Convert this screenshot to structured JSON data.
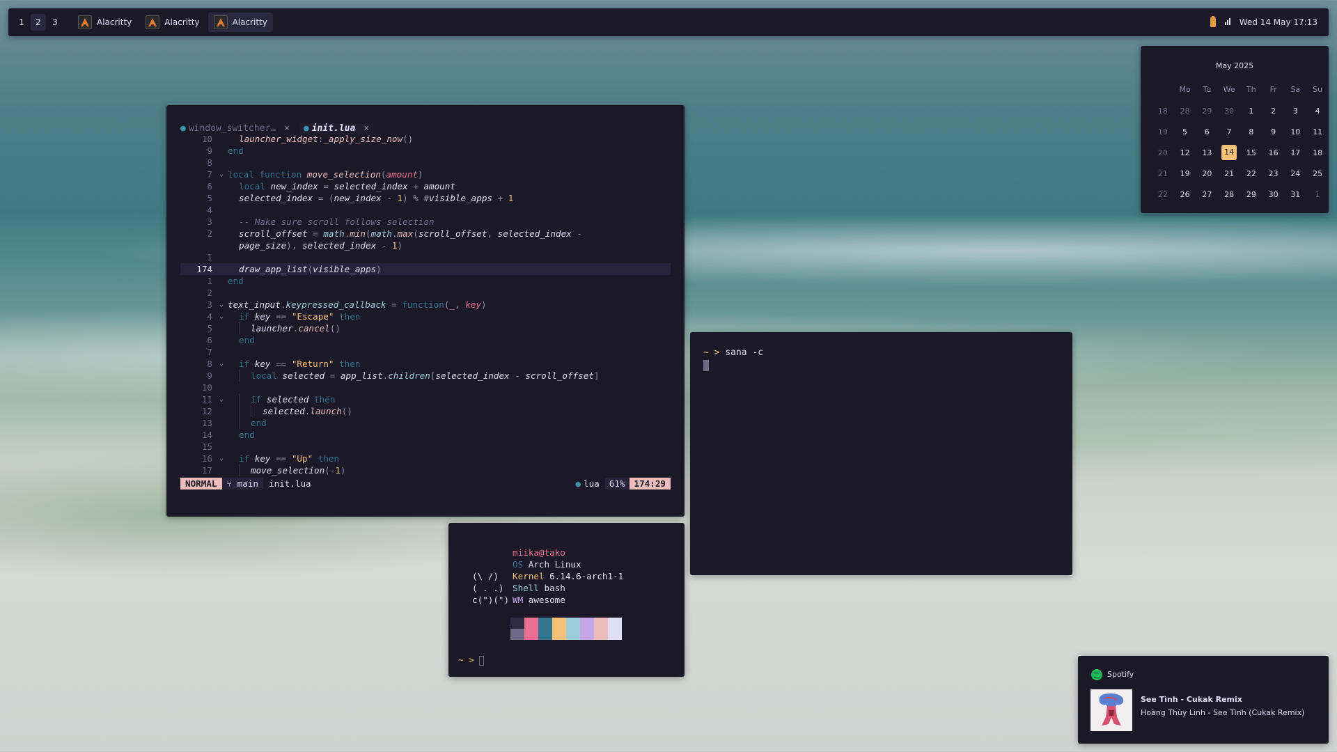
{
  "topbar": {
    "workspaces": [
      "1",
      "2",
      "3"
    ],
    "active_workspace": "2",
    "tasks": [
      {
        "label": "Alacritty",
        "icon": "alacritty-icon"
      },
      {
        "label": "Alacritty",
        "icon": "alacritty-icon"
      },
      {
        "label": "Alacritty",
        "icon": "alacritty-icon"
      }
    ],
    "clock": "Wed 14 May 17:13"
  },
  "calendar": {
    "title": "May 2025",
    "weekdays": [
      "Mo",
      "Tu",
      "We",
      "Th",
      "Fr",
      "Sa",
      "Su"
    ],
    "weeks": [
      {
        "week": "18",
        "days": [
          "28",
          "29",
          "30",
          "1",
          "2",
          "3",
          "4"
        ]
      },
      {
        "week": "19",
        "days": [
          "5",
          "6",
          "7",
          "8",
          "9",
          "10",
          "11"
        ]
      },
      {
        "week": "20",
        "days": [
          "12",
          "13",
          "14",
          "15",
          "16",
          "17",
          "18"
        ]
      },
      {
        "week": "21",
        "days": [
          "19",
          "20",
          "21",
          "22",
          "23",
          "24",
          "25"
        ]
      },
      {
        "week": "22",
        "days": [
          "26",
          "27",
          "28",
          "29",
          "30",
          "31",
          "1"
        ]
      }
    ],
    "today": "14",
    "accent": "#f6c177"
  },
  "editor": {
    "tabs": [
      {
        "label": "window_switcher…",
        "close": "×"
      },
      {
        "label": "init.lua",
        "close": "×"
      }
    ],
    "lines": [
      {
        "num": "10",
        "fold": "",
        "indent": 1,
        "tokens": [
          [
            "fn",
            "launcher_widget"
          ],
          [
            "op",
            ":"
          ],
          [
            "fn",
            "_apply_size_now"
          ],
          [
            "op",
            "()"
          ]
        ]
      },
      {
        "num": "9",
        "fold": "",
        "indent": 0,
        "tokens": [
          [
            "kw",
            "end"
          ]
        ]
      },
      {
        "num": "8",
        "fold": "",
        "indent": 0,
        "tokens": []
      },
      {
        "num": "7",
        "fold": "v",
        "indent": 0,
        "tokens": [
          [
            "kw",
            "local function "
          ],
          [
            "fn",
            "move_selection"
          ],
          [
            "op",
            "("
          ],
          [
            "pl",
            "amount"
          ],
          [
            "op",
            ")"
          ]
        ]
      },
      {
        "num": "6",
        "fold": "",
        "indent": 1,
        "tokens": [
          [
            "kw",
            "local "
          ],
          [
            "id",
            "new_index"
          ],
          [
            "op",
            " = "
          ],
          [
            "id",
            "selected_index"
          ],
          [
            "op",
            " + "
          ],
          [
            "id",
            "amount"
          ]
        ]
      },
      {
        "num": "5",
        "fold": "",
        "indent": 1,
        "tokens": [
          [
            "id",
            "selected_index"
          ],
          [
            "op",
            " = ("
          ],
          [
            "id",
            "new_index"
          ],
          [
            "op",
            " - "
          ],
          [
            "num2",
            "1"
          ],
          [
            "op",
            ") % #"
          ],
          [
            "id",
            "visible_apps"
          ],
          [
            "op",
            " + "
          ],
          [
            "num2",
            "1"
          ]
        ]
      },
      {
        "num": "4",
        "fold": "",
        "indent": 0,
        "tokens": []
      },
      {
        "num": "3",
        "fold": "",
        "indent": 1,
        "tokens": [
          [
            "cm",
            "-- Make sure scroll follows selection"
          ]
        ]
      },
      {
        "num": "2",
        "fold": "",
        "indent": 1,
        "tokens": [
          [
            "id",
            "scroll_offset"
          ],
          [
            "op",
            " = "
          ],
          [
            "fld",
            "math"
          ],
          [
            "op",
            "."
          ],
          [
            "mth",
            "min"
          ],
          [
            "op",
            "("
          ],
          [
            "fld",
            "math"
          ],
          [
            "op",
            "."
          ],
          [
            "mth",
            "max"
          ],
          [
            "op",
            "("
          ],
          [
            "id",
            "scroll_offset"
          ],
          [
            "op",
            ", "
          ],
          [
            "id",
            "selected_index"
          ],
          [
            "op",
            " -"
          ]
        ]
      },
      {
        "num": "",
        "fold": "",
        "indent": 1,
        "tokens": [
          [
            "id",
            "page_size"
          ],
          [
            "op",
            "), "
          ],
          [
            "id",
            "selected_index"
          ],
          [
            "op",
            " - "
          ],
          [
            "num2",
            "1"
          ],
          [
            "op",
            ")"
          ]
        ]
      },
      {
        "num": "1",
        "fold": "",
        "indent": 0,
        "tokens": []
      },
      {
        "num": "174",
        "fold": "",
        "indent": 1,
        "current": true,
        "tokens": [
          [
            "id",
            "draw_app_list"
          ],
          [
            "op",
            "("
          ],
          [
            "id",
            "visible_apps"
          ],
          [
            "op",
            ")"
          ]
        ]
      },
      {
        "num": "1",
        "fold": "",
        "indent": 0,
        "tokens": [
          [
            "kw",
            "end"
          ]
        ]
      },
      {
        "num": "2",
        "fold": "",
        "indent": 0,
        "tokens": []
      },
      {
        "num": "3",
        "fold": "v",
        "indent": 0,
        "tokens": [
          [
            "id",
            "text_input"
          ],
          [
            "op",
            "."
          ],
          [
            "fld",
            "keypressed_callback"
          ],
          [
            "op",
            " = "
          ],
          [
            "kw",
            "function"
          ],
          [
            "op",
            "("
          ],
          [
            "pl",
            "_"
          ],
          [
            "op",
            ", "
          ],
          [
            "pl",
            "key"
          ],
          [
            "op",
            ")"
          ]
        ]
      },
      {
        "num": "4",
        "fold": "v",
        "indent": 1,
        "tokens": [
          [
            "kw",
            "if "
          ],
          [
            "id",
            "key"
          ],
          [
            "op",
            " == "
          ],
          [
            "str",
            "\"Escape\""
          ],
          [
            "kw",
            " then"
          ]
        ]
      },
      {
        "num": "5",
        "fold": "",
        "indent": 2,
        "tokens": [
          [
            "id",
            "launcher"
          ],
          [
            "op",
            "."
          ],
          [
            "mth",
            "cancel"
          ],
          [
            "op",
            "()"
          ]
        ]
      },
      {
        "num": "6",
        "fold": "",
        "indent": 1,
        "tokens": [
          [
            "kw",
            "end"
          ]
        ]
      },
      {
        "num": "7",
        "fold": "",
        "indent": 0,
        "tokens": []
      },
      {
        "num": "8",
        "fold": "v",
        "indent": 1,
        "tokens": [
          [
            "kw",
            "if "
          ],
          [
            "id",
            "key"
          ],
          [
            "op",
            " == "
          ],
          [
            "str",
            "\"Return\""
          ],
          [
            "kw",
            " then"
          ]
        ]
      },
      {
        "num": "9",
        "fold": "",
        "indent": 2,
        "tokens": [
          [
            "kw",
            "local "
          ],
          [
            "id",
            "selected"
          ],
          [
            "op",
            " = "
          ],
          [
            "id",
            "app_list"
          ],
          [
            "op",
            "."
          ],
          [
            "fld",
            "children"
          ],
          [
            "op",
            "["
          ],
          [
            "id",
            "selected_index"
          ],
          [
            "op",
            " - "
          ],
          [
            "id",
            "scroll_offset"
          ],
          [
            "op",
            "]"
          ]
        ]
      },
      {
        "num": "10",
        "fold": "",
        "indent": 0,
        "tokens": []
      },
      {
        "num": "11",
        "fold": "v",
        "indent": 2,
        "tokens": [
          [
            "kw",
            "if "
          ],
          [
            "id",
            "selected"
          ],
          [
            "kw",
            " then"
          ]
        ]
      },
      {
        "num": "12",
        "fold": "",
        "indent": 3,
        "tokens": [
          [
            "id",
            "selected"
          ],
          [
            "op",
            "."
          ],
          [
            "mth",
            "launch"
          ],
          [
            "op",
            "()"
          ]
        ]
      },
      {
        "num": "13",
        "fold": "",
        "indent": 2,
        "tokens": [
          [
            "kw",
            "end"
          ]
        ]
      },
      {
        "num": "14",
        "fold": "",
        "indent": 1,
        "tokens": [
          [
            "kw",
            "end"
          ]
        ]
      },
      {
        "num": "15",
        "fold": "",
        "indent": 0,
        "tokens": []
      },
      {
        "num": "16",
        "fold": "v",
        "indent": 1,
        "tokens": [
          [
            "kw",
            "if "
          ],
          [
            "id",
            "key"
          ],
          [
            "op",
            " == "
          ],
          [
            "str",
            "\"Up\""
          ],
          [
            "kw",
            " then"
          ]
        ]
      },
      {
        "num": "17",
        "fold": "",
        "indent": 2,
        "tokens": [
          [
            "id",
            "move_selection"
          ],
          [
            "op",
            "(-"
          ],
          [
            "num2",
            "1"
          ],
          [
            "op",
            ")"
          ]
        ]
      }
    ],
    "status": {
      "mode": "NORMAL",
      "branch": "main",
      "filename": "init.lua",
      "filetype": "lua",
      "percent": "61%",
      "position": "174:29"
    }
  },
  "terminal": {
    "prompt_symbol": "~ >",
    "command": "sana -c"
  },
  "fetch": {
    "user_host": "miika@tako",
    "rows": [
      {
        "key": "OS",
        "value": "Arch Linux",
        "key_color": "#31748f"
      },
      {
        "key": "Kernel",
        "value": "6.14.6-arch1-1",
        "key_color": "#f6c177"
      },
      {
        "key": "Shell",
        "value": "bash",
        "key_color": "#9ccfd8"
      },
      {
        "key": "WM",
        "value": "awesome",
        "key_color": "#c4a7e7"
      }
    ],
    "ascii": [
      "(\\ /)",
      "( . .)",
      "c(\")(\")"
    ],
    "swatches_top": [
      "#26233a",
      "#eb6f92",
      "#31748f",
      "#f6c177",
      "#9ccfd8",
      "#c4a7e7",
      "#ebbcba",
      "#e0def4"
    ],
    "swatches_bottom": [
      "#6e6a86",
      "#eb6f92",
      "#31748f",
      "#f6c177",
      "#9ccfd8",
      "#c4a7e7",
      "#ebbcba",
      "#e0def4"
    ],
    "prompt": "~ >"
  },
  "spotify": {
    "app": "Spotify",
    "title": "See Tình - Cukak Remix",
    "artist": "Hoàng Thùy Linh - See Tình (Cukak Remix)"
  }
}
